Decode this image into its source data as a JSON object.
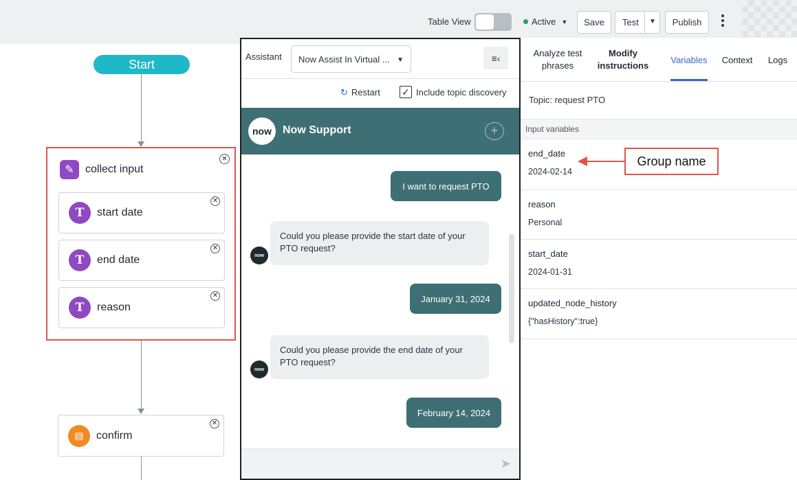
{
  "toolbar": {
    "table_view_label": "Table View",
    "status_label": "Active",
    "save_label": "Save",
    "test_label": "Test",
    "publish_label": "Publish"
  },
  "flow": {
    "start_label": "Start",
    "group_label": "collect input",
    "children": [
      "start date",
      "end date",
      "reason"
    ],
    "confirm_label": "confirm"
  },
  "assistant": {
    "label": "Assistant",
    "selected": "Now Assist In Virtual ...",
    "restart_label": "Restart",
    "include_topic_label": "Include topic discovery",
    "include_topic_checked": true,
    "chat_title": "Now Support",
    "logo_text": "now",
    "messages": [
      {
        "from": "user",
        "text": "I want to request PTO"
      },
      {
        "from": "bot",
        "text": "Could you please provide the start date of your PTO request?"
      },
      {
        "from": "user",
        "text": "January 31, 2024"
      },
      {
        "from": "bot",
        "text": "Could you please provide the end date of your PTO request?"
      },
      {
        "from": "user",
        "text": "February 14, 2024"
      }
    ]
  },
  "panel": {
    "tabs": [
      {
        "label": "Analyze test phrases",
        "active": false
      },
      {
        "label": "Modify instructions",
        "active": false
      },
      {
        "label": "Variables",
        "active": true
      },
      {
        "label": "Context",
        "active": false
      },
      {
        "label": "Logs",
        "active": false
      }
    ],
    "topic_label": "Topic:",
    "topic_value": "request PTO",
    "section_title": "Input variables",
    "variables": [
      {
        "name": "end_date",
        "value": "2024-02-14"
      },
      {
        "name": "reason",
        "value": "Personal"
      },
      {
        "name": "start_date",
        "value": "2024-01-31"
      },
      {
        "name": "updated_node_history",
        "value": "{\"hasHistory\":true}"
      }
    ]
  },
  "annotation": {
    "label": "Group name"
  },
  "colors": {
    "accent": "#3b68c4",
    "chat_header": "#3e6f74",
    "start_pill": "#1fb8c8",
    "highlight": "#e4534a",
    "node_icon": "#8f49c2",
    "confirm_icon": "#f08a24"
  }
}
